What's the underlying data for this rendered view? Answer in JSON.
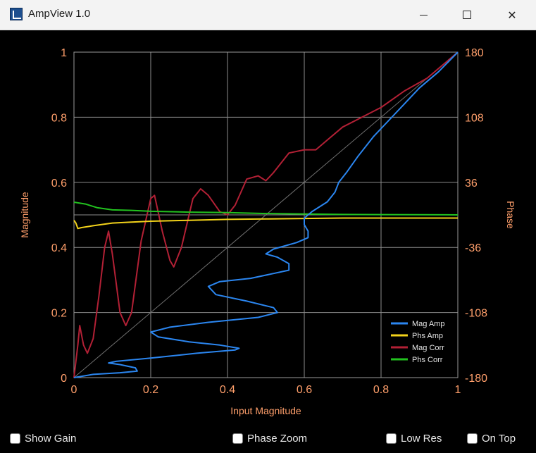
{
  "window": {
    "title": "AmpView 1.0",
    "icon": "app-icon",
    "controls": [
      "minimize-icon",
      "maximize-icon",
      "close-icon"
    ]
  },
  "chart_data": {
    "type": "line",
    "xlabel": "Input Magnitude",
    "ylabel_left": "Magnitude",
    "ylabel_right": "Phase",
    "xlim": [
      0,
      1
    ],
    "ylim_left": [
      0,
      1
    ],
    "ylim_right": [
      -180,
      180
    ],
    "x_ticks": [
      "0",
      "0.2",
      "0.4",
      "0.6",
      "0.8",
      "1"
    ],
    "y_ticks_left": [
      "0",
      "0.2",
      "0.4",
      "0.6",
      "0.8",
      "1"
    ],
    "y_ticks_right": [
      "-180",
      "-108",
      "-36",
      "36",
      "108",
      "180"
    ],
    "grid": true,
    "legend_position": "bottom-right",
    "background": "#000000",
    "axis_color": "#ff9f6b",
    "series": [
      {
        "name": "Mag Amp",
        "color": "#2b86f0",
        "points": [
          [
            0,
            0
          ],
          [
            0.05,
            0.01
          ],
          [
            0.12,
            0.015
          ],
          [
            0.165,
            0.02
          ],
          [
            0.16,
            0.03
          ],
          [
            0.12,
            0.04
          ],
          [
            0.09,
            0.045
          ],
          [
            0.11,
            0.05
          ],
          [
            0.2,
            0.06
          ],
          [
            0.32,
            0.075
          ],
          [
            0.42,
            0.085
          ],
          [
            0.43,
            0.09
          ],
          [
            0.38,
            0.1
          ],
          [
            0.3,
            0.11
          ],
          [
            0.22,
            0.125
          ],
          [
            0.2,
            0.14
          ],
          [
            0.25,
            0.155
          ],
          [
            0.35,
            0.17
          ],
          [
            0.48,
            0.185
          ],
          [
            0.53,
            0.2
          ],
          [
            0.52,
            0.215
          ],
          [
            0.45,
            0.235
          ],
          [
            0.37,
            0.255
          ],
          [
            0.35,
            0.28
          ],
          [
            0.38,
            0.295
          ],
          [
            0.46,
            0.305
          ],
          [
            0.52,
            0.32
          ],
          [
            0.56,
            0.33
          ],
          [
            0.56,
            0.35
          ],
          [
            0.53,
            0.37
          ],
          [
            0.5,
            0.38
          ],
          [
            0.52,
            0.395
          ],
          [
            0.58,
            0.415
          ],
          [
            0.61,
            0.43
          ],
          [
            0.61,
            0.45
          ],
          [
            0.6,
            0.47
          ],
          [
            0.6,
            0.49
          ],
          [
            0.62,
            0.51
          ],
          [
            0.66,
            0.54
          ],
          [
            0.68,
            0.57
          ],
          [
            0.69,
            0.6
          ],
          [
            0.71,
            0.63
          ],
          [
            0.74,
            0.68
          ],
          [
            0.78,
            0.74
          ],
          [
            0.82,
            0.79
          ],
          [
            0.86,
            0.84
          ],
          [
            0.9,
            0.89
          ],
          [
            0.95,
            0.94
          ],
          [
            1,
            1
          ]
        ]
      },
      {
        "name": "Phs Amp",
        "color": "#f2d21a",
        "points": [
          [
            0,
            -6
          ],
          [
            0.005,
            -9
          ],
          [
            0.01,
            -15
          ],
          [
            0.02,
            -14
          ],
          [
            0.05,
            -12
          ],
          [
            0.1,
            -9
          ],
          [
            0.15,
            -8
          ],
          [
            0.2,
            -7
          ],
          [
            0.3,
            -6
          ],
          [
            0.4,
            -5
          ],
          [
            0.5,
            -4.5
          ],
          [
            0.6,
            -4
          ],
          [
            0.7,
            -3.5
          ],
          [
            0.8,
            -3.5
          ],
          [
            0.9,
            -3.5
          ],
          [
            1,
            -3.5
          ]
        ]
      },
      {
        "name": "Mag Corr",
        "color": "#b22035",
        "points": [
          [
            0,
            0
          ],
          [
            0.01,
            0.1
          ],
          [
            0.015,
            0.16
          ],
          [
            0.025,
            0.1
          ],
          [
            0.035,
            0.075
          ],
          [
            0.05,
            0.12
          ],
          [
            0.065,
            0.25
          ],
          [
            0.08,
            0.4
          ],
          [
            0.09,
            0.45
          ],
          [
            0.1,
            0.38
          ],
          [
            0.12,
            0.2
          ],
          [
            0.135,
            0.16
          ],
          [
            0.15,
            0.2
          ],
          [
            0.175,
            0.42
          ],
          [
            0.2,
            0.55
          ],
          [
            0.21,
            0.56
          ],
          [
            0.23,
            0.45
          ],
          [
            0.25,
            0.36
          ],
          [
            0.26,
            0.34
          ],
          [
            0.28,
            0.4
          ],
          [
            0.31,
            0.55
          ],
          [
            0.33,
            0.58
          ],
          [
            0.35,
            0.56
          ],
          [
            0.38,
            0.51
          ],
          [
            0.4,
            0.5
          ],
          [
            0.42,
            0.53
          ],
          [
            0.45,
            0.61
          ],
          [
            0.48,
            0.62
          ],
          [
            0.5,
            0.605
          ],
          [
            0.52,
            0.63
          ],
          [
            0.56,
            0.69
          ],
          [
            0.6,
            0.7
          ],
          [
            0.63,
            0.7
          ],
          [
            0.66,
            0.73
          ],
          [
            0.7,
            0.77
          ],
          [
            0.75,
            0.8
          ],
          [
            0.8,
            0.83
          ],
          [
            0.86,
            0.88
          ],
          [
            0.92,
            0.92
          ],
          [
            1,
            1
          ]
        ]
      },
      {
        "name": "Phs Corr",
        "color": "#22c21f",
        "points": [
          [
            0,
            14
          ],
          [
            0.03,
            12
          ],
          [
            0.06,
            8
          ],
          [
            0.1,
            5.5
          ],
          [
            0.15,
            5
          ],
          [
            0.2,
            4
          ],
          [
            0.3,
            3
          ],
          [
            0.4,
            2.5
          ],
          [
            0.5,
            1.5
          ],
          [
            0.6,
            1
          ],
          [
            0.7,
            0.5
          ],
          [
            0.8,
            0.3
          ],
          [
            0.9,
            0.2
          ],
          [
            1,
            0
          ]
        ]
      }
    ]
  },
  "footer": {
    "show_gain": {
      "label": "Show Gain",
      "checked": false
    },
    "phase_zoom": {
      "label": "Phase Zoom",
      "checked": false
    },
    "low_res": {
      "label": "Low Res",
      "checked": false
    },
    "on_top": {
      "label": "On Top",
      "checked": false
    }
  }
}
